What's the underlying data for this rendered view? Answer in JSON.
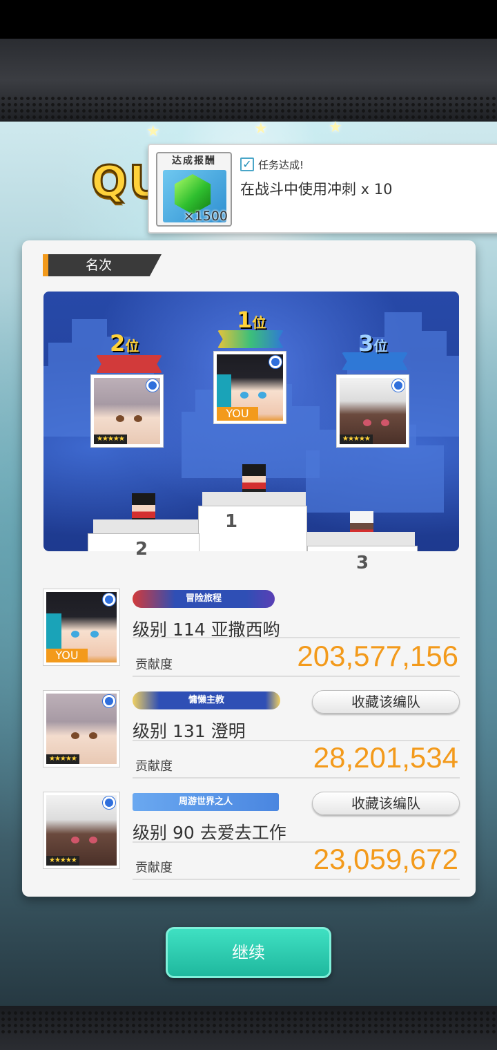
{
  "header": {
    "title_partial": "QU"
  },
  "mission": {
    "reward_label": "达成报酬",
    "reward_count": "×1500",
    "reward_icon": "green-gem-icon",
    "status": "任务达成!",
    "description": "在战斗中使用冲刺  x 10"
  },
  "panel": {
    "section_title": "名次",
    "podium": {
      "first": {
        "rank_num": "1",
        "rank_suffix": "位",
        "you_tag": "YOU",
        "color": "#3cbf7a"
      },
      "second": {
        "rank_num": "2",
        "rank_suffix": "位",
        "stars": "★★★★★",
        "color": "#d23a3a"
      },
      "third": {
        "rank_num": "3",
        "rank_suffix": "位",
        "stars": "★★★★★",
        "color": "#2f78d6"
      },
      "step_labels": [
        "2",
        "1",
        "3"
      ]
    },
    "rankings": [
      {
        "title": "冒险旅程",
        "name": "级别 114 亚撒西哟",
        "contrib_label": "贡献度",
        "contrib_value": "203,577,156",
        "you_tag": "YOU"
      },
      {
        "title": "慵懒主教",
        "name": "级别 131 澄明",
        "contrib_label": "贡献度",
        "contrib_value": "28,201,534",
        "stars": "★★★★★",
        "button": "收藏该编队"
      },
      {
        "title": "周游世界之人",
        "name": "级别 90 去爱去工作",
        "contrib_label": "贡献度",
        "contrib_value": "23,059,672",
        "stars": "★★★★★",
        "button": "收藏该编队"
      }
    ]
  },
  "footer": {
    "continue_label": "继续"
  },
  "colors": {
    "accent": "#f39a1b",
    "continue": "#26c8aa",
    "badge": "#2f6fdc"
  }
}
